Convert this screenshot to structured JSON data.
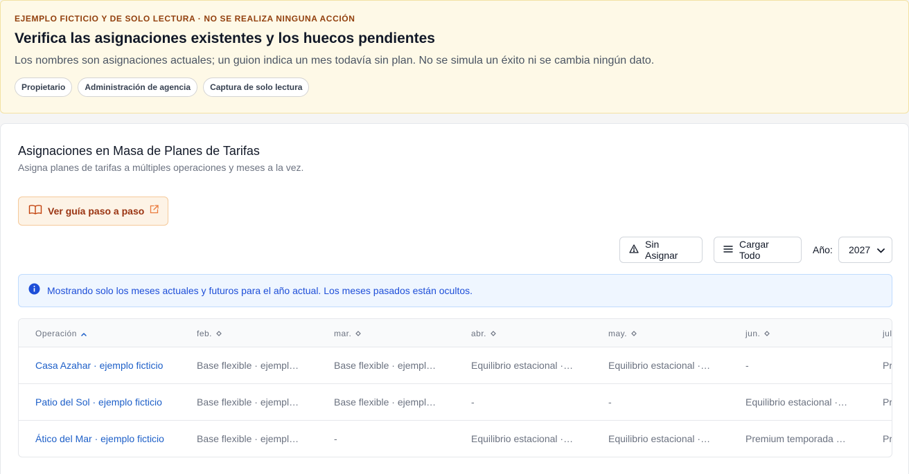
{
  "banner": {
    "eyebrow": "EJEMPLO FICTICIO Y DE SOLO LECTURA · NO SE REALIZA NINGUNA ACCIÓN",
    "title": "Verifica las asignaciones existentes y los huecos pendientes",
    "description": "Los nombres son asignaciones actuales; un guion indica un mes todavía sin plan. No se simula un éxito ni se cambia ningún dato.",
    "chips": [
      "Propietario",
      "Administración de agencia",
      "Captura de solo lectura"
    ]
  },
  "page": {
    "title": "Asignaciones en Masa de Planes de Tarifas",
    "subtitle": "Asigna planes de tarifas a múltiples operaciones y meses a la vez.",
    "guide_label": "Ver guía paso a paso"
  },
  "toolbar": {
    "unassigned_label": "Sin Asignar",
    "load_all_label": "Cargar Todo",
    "year_label": "Año:",
    "year_value": "2027"
  },
  "info": {
    "text": "Mostrando solo los meses actuales y futuros para el año actual. Los meses pasados están ocultos."
  },
  "table": {
    "columns": [
      "Operación",
      "feb.",
      "mar.",
      "abr.",
      "may.",
      "jun.",
      "jul."
    ],
    "rows": [
      {
        "operation": "Casa Azahar · ejemplo ficticio",
        "cells": [
          "Base flexible · ejemplo ficticio",
          "Base flexible · ejemplo ficticio",
          "Equilibrio estacional · ejemplo ficticio",
          "Equilibrio estacional · ejemplo ficticio",
          "-",
          "Premium temporada alta"
        ]
      },
      {
        "operation": "Patio del Sol · ejemplo ficticio",
        "cells": [
          "Base flexible · ejemplo ficticio",
          "Base flexible · ejemplo ficticio",
          "-",
          "-",
          "Equilibrio estacional · ejemplo ficticio",
          "Premium temporada alta"
        ]
      },
      {
        "operation": "Ático del Mar · ejemplo ficticio",
        "cells": [
          "Base flexible · ejemplo ficticio",
          "-",
          "Equilibrio estacional · ejemplo ficticio",
          "Equilibrio estacional · ejemplo ficticio",
          "Premium temporada alta",
          "Premium temporada alta"
        ]
      }
    ]
  },
  "colors": {
    "banner_bg": "#fef9e7",
    "eyebrow": "#92400e",
    "link_blue": "#1d5fc8",
    "info_bg": "#eff6ff",
    "guide_accent": "#9a3412"
  },
  "icons": {
    "guide": "book-open-icon",
    "external": "external-link-icon",
    "unassigned": "alert-triangle-icon",
    "load_all": "menu-lines-icon",
    "info": "info-circle-icon",
    "sort_asc": "chevron-up-icon",
    "sort_both": "sort-diamond-icon"
  }
}
